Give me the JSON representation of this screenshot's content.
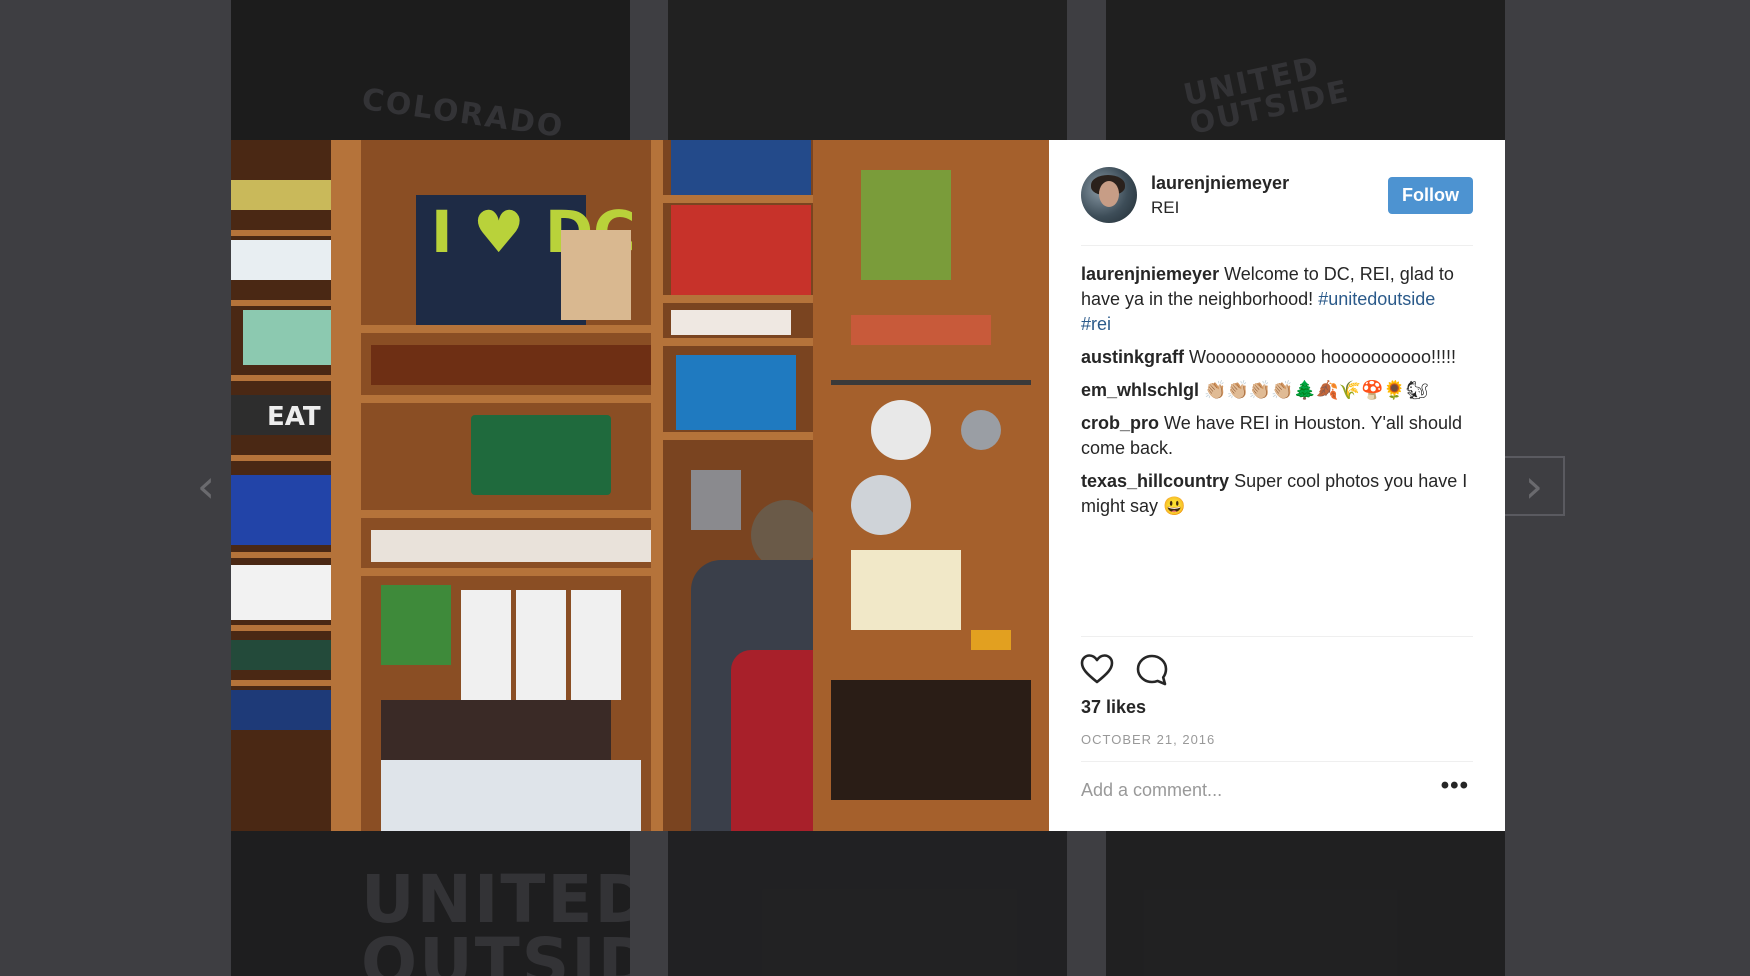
{
  "background_tiles": {
    "top_right_text": "UNITED OUTSIDE",
    "bottom_left_text": "UNITED OUTSIDE",
    "top_left_text": "COLORADO"
  },
  "nav": {
    "prev": "‹",
    "next": "›"
  },
  "photo": {
    "sign_text": "I ♥ DC",
    "eat_sign": "EAT"
  },
  "post": {
    "username": "laurenjniemeyer",
    "location": "REI",
    "follow_label": "Follow",
    "caption": {
      "user": "laurenjniemeyer",
      "text": "Welcome to DC, REI, glad to have ya in the neighborhood!",
      "hashtags": "#unitedoutside #rei"
    },
    "comments": [
      {
        "user": "austinkgraff",
        "text": "Wooooooooooo hoooooooooo!!!!!"
      },
      {
        "user": "em_whlschlgl",
        "text": "👏🏼👏🏼👏🏼👏🏼🌲🍂🌾🍄🌻🐿"
      },
      {
        "user": "crob_pro",
        "text": "We have REI in Houston. Y'all should come back."
      },
      {
        "user": "texas_hillcountry",
        "text": "Super cool photos you have I might say 😃"
      }
    ],
    "like_icon": "heart-icon",
    "comment_icon": "comment-bubble-icon",
    "likes": "37 likes",
    "date": "OCTOBER 21, 2016",
    "add_comment_placeholder": "Add a comment...",
    "more_label": "•••"
  }
}
